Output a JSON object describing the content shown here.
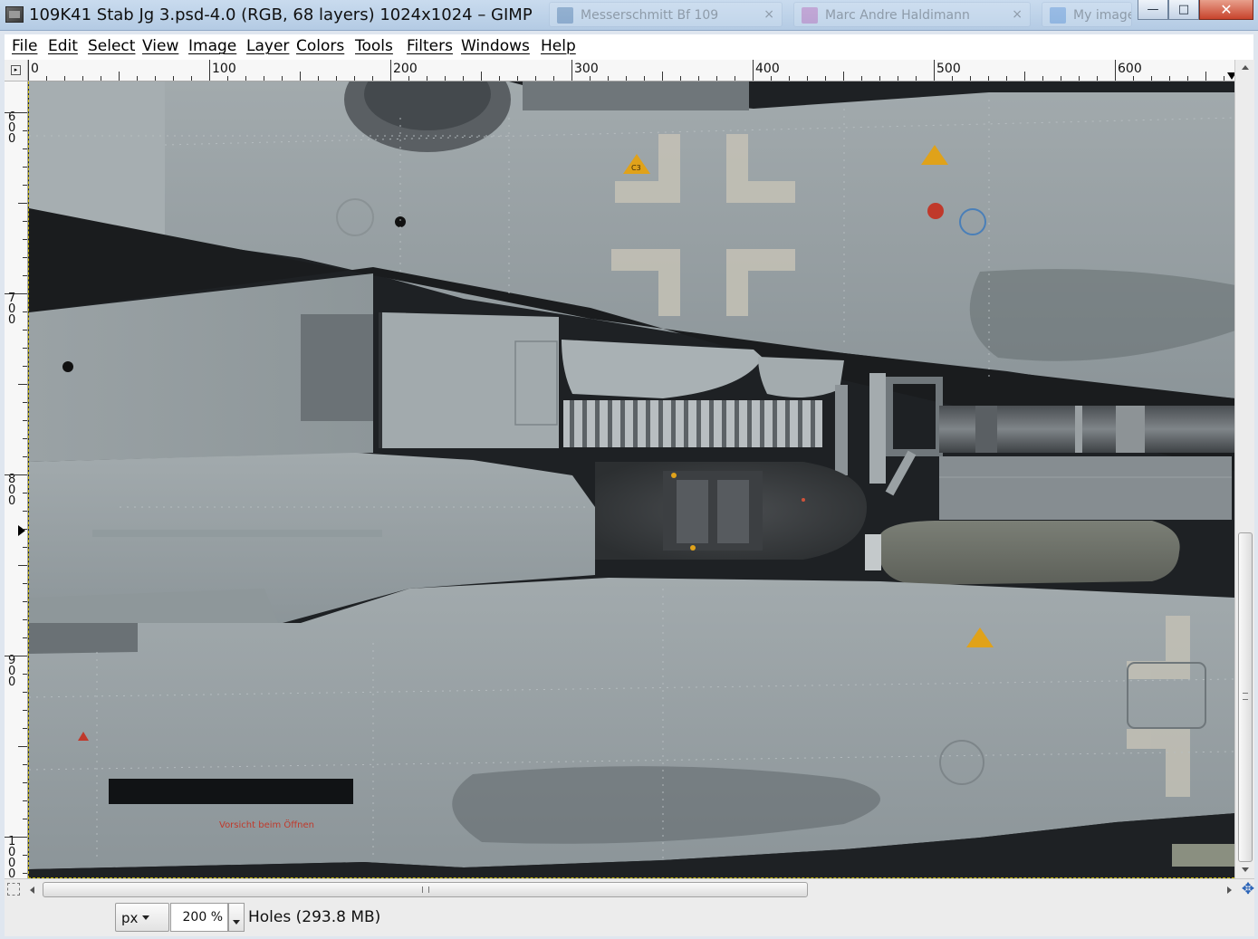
{
  "window": {
    "title": "109K41 Stab Jg 3.psd-4.0 (RGB, 68 layers) 1024x1024 – GIMP",
    "background_tabs": [
      {
        "label": "Messerschmitt Bf 109",
        "color": "#3a6aa0"
      },
      {
        "label": "Marc Andre Haldimann",
        "color": "#c052b0"
      },
      {
        "label": "My images",
        "color": "#4a8ad8"
      }
    ],
    "controls": {
      "minimize": "—",
      "maximize": "□",
      "close": "✕"
    }
  },
  "menu": [
    {
      "label": "File",
      "icon": ""
    },
    {
      "label": "Edit"
    },
    {
      "label": "Select"
    },
    {
      "label": "View"
    },
    {
      "label": "Image"
    },
    {
      "label": "Layer"
    },
    {
      "label": "Colors"
    },
    {
      "label": "Tools"
    },
    {
      "label": "Filters"
    },
    {
      "label": "Windows"
    },
    {
      "label": "Help"
    }
  ],
  "rulers": {
    "horizontal_labels": [
      "0",
      "100",
      "200",
      "300",
      "400",
      "500",
      "600"
    ],
    "vertical_labels": [
      "600",
      "700",
      "800",
      "900",
      "1000"
    ]
  },
  "status": {
    "unit": "px",
    "zoom": "200 %",
    "message": "Holes (293.8 MB)"
  },
  "canvas_texts": {
    "warning_red": "Vorsicht beim Öffnen",
    "marking_c3": "C3"
  },
  "colors": {
    "panel_gray": "#8e979b",
    "panel_light": "#a3abae",
    "background_dark": "#1e2124",
    "stencil_red": "#c0392b",
    "stencil_yellow": "#e0a21a"
  }
}
